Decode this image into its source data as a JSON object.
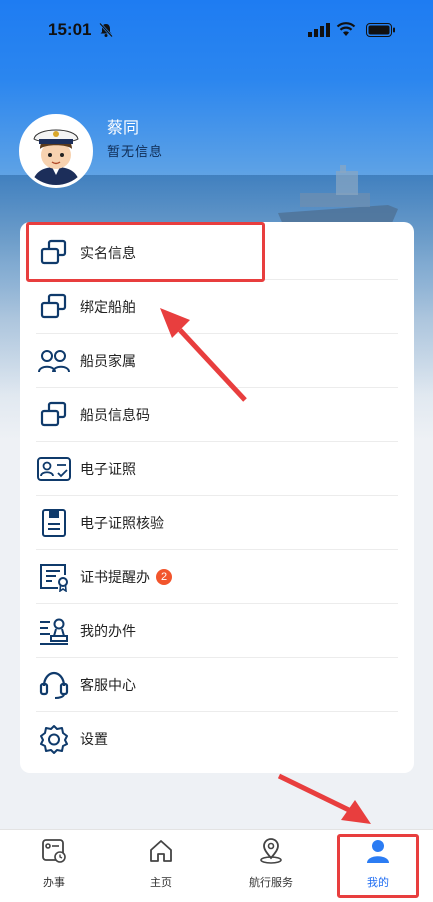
{
  "status_bar": {
    "time": "15:01"
  },
  "profile": {
    "name": "蔡同",
    "info": "暂无信息"
  },
  "menu": [
    {
      "label": "实名信息",
      "icon": "id-card-icon"
    },
    {
      "label": "绑定船舶",
      "icon": "link-ship-icon"
    },
    {
      "label": "船员家属",
      "icon": "family-icon"
    },
    {
      "label": "船员信息码",
      "icon": "qr-info-icon"
    },
    {
      "label": "电子证照",
      "icon": "license-icon"
    },
    {
      "label": "电子证照核验",
      "icon": "verify-icon"
    },
    {
      "label": "证书提醒办",
      "icon": "certificate-icon",
      "badge": "2"
    },
    {
      "label": "我的办件",
      "icon": "my-task-icon"
    },
    {
      "label": "客服中心",
      "icon": "headset-icon"
    },
    {
      "label": "设置",
      "icon": "gear-icon"
    }
  ],
  "tabs": [
    {
      "label": "办事",
      "icon": "services-icon"
    },
    {
      "label": "主页",
      "icon": "home-icon"
    },
    {
      "label": "航行服务",
      "icon": "location-icon"
    },
    {
      "label": "我的",
      "icon": "profile-icon",
      "active": true
    }
  ],
  "colors": {
    "accent": "#1e6cf2",
    "icon_navy": "#0f3a6b",
    "highlight": "#e83e3e",
    "badge": "#f2552c"
  }
}
